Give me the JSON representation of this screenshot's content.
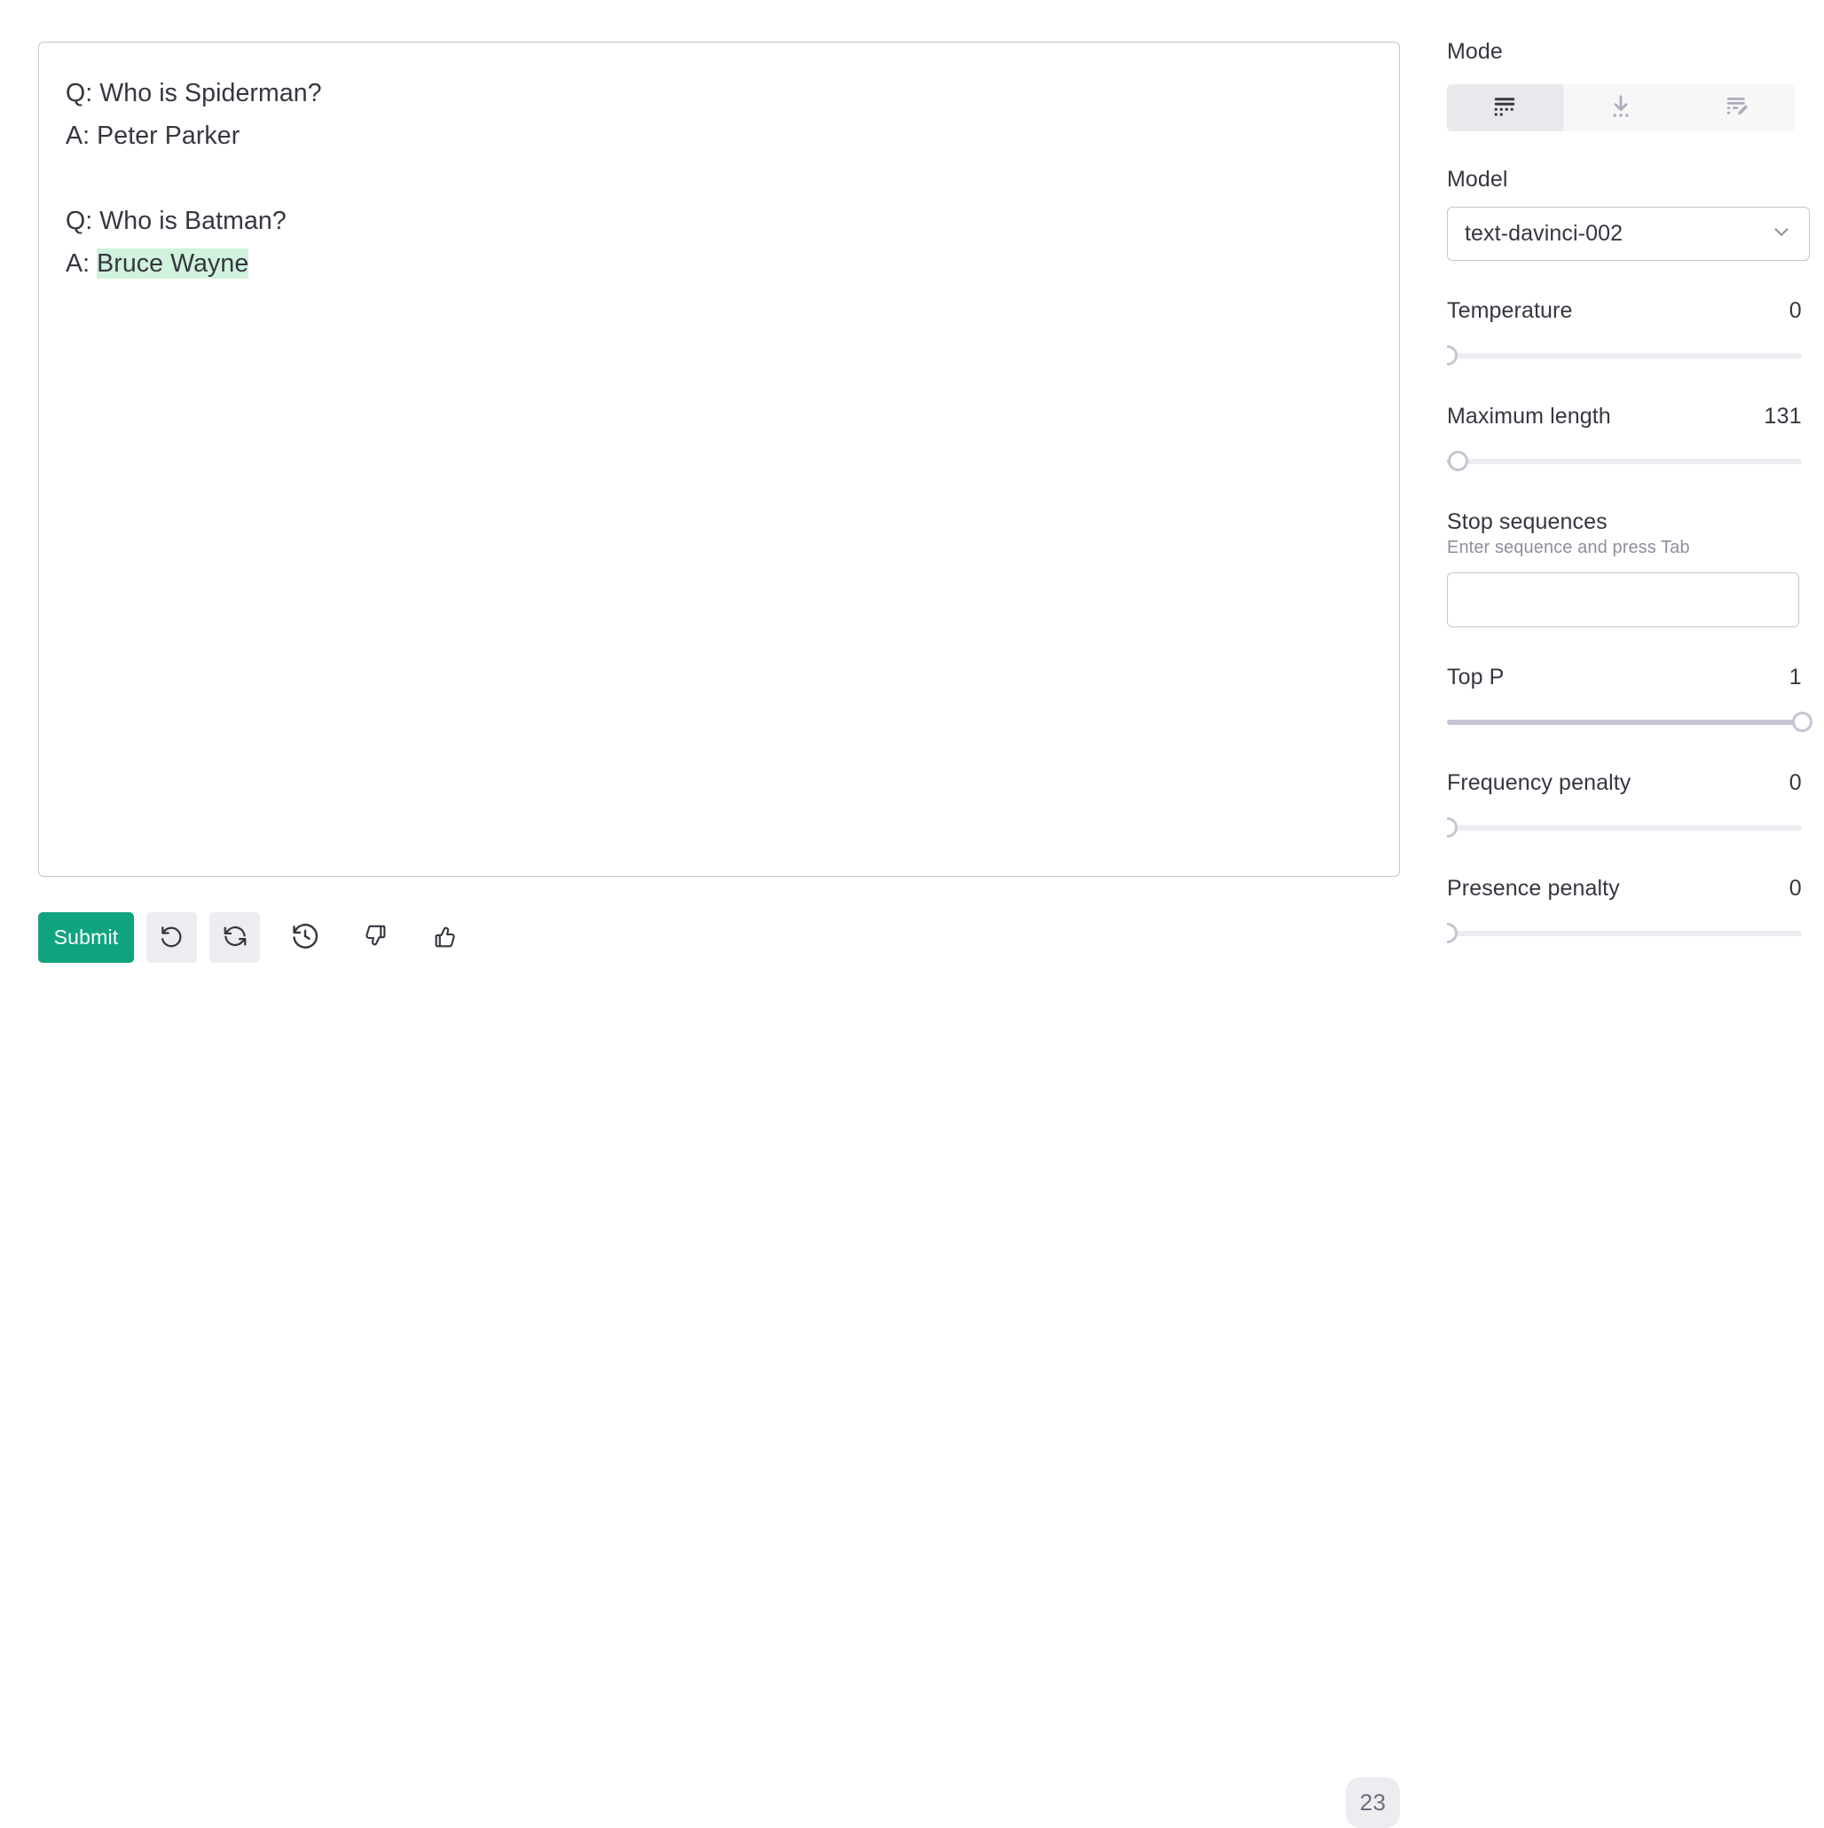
{
  "editor": {
    "prompt_lines": [
      "Q: Who is Spiderman?",
      "A: Peter Parker",
      "",
      "Q: Who is Batman?"
    ],
    "answer_prefix": "A: ",
    "completion_text": "Bruce Wayne",
    "completion_highlight_color": "#d1f2dc"
  },
  "toolbar": {
    "submit_label": "Submit",
    "undo_icon": "undo-icon",
    "regenerate_icon": "regenerate-icon",
    "history_icon": "history-icon",
    "thumbs_down_icon": "thumbs-down-icon",
    "thumbs_up_icon": "thumbs-up-icon",
    "token_count": "23",
    "submit_color": "#10a37f"
  },
  "sidebar": {
    "mode": {
      "label": "Mode",
      "options": [
        {
          "name": "complete",
          "icon": "complete-mode-icon",
          "selected": true
        },
        {
          "name": "insert",
          "icon": "insert-mode-icon",
          "selected": false
        },
        {
          "name": "edit",
          "icon": "edit-mode-icon",
          "selected": false
        }
      ]
    },
    "model": {
      "label": "Model",
      "value": "text-davinci-002",
      "chevron_icon": "chevron-down-icon"
    },
    "temperature": {
      "label": "Temperature",
      "value": "0",
      "percent": 0
    },
    "maximum_length": {
      "label": "Maximum length",
      "value": "131",
      "percent": 3
    },
    "stop_sequences": {
      "label": "Stop sequences",
      "hint": "Enter sequence and press Tab",
      "value": ""
    },
    "top_p": {
      "label": "Top P",
      "value": "1",
      "percent": 100
    },
    "frequency_penalty": {
      "label": "Frequency penalty",
      "value": "0",
      "percent": 0
    },
    "presence_penalty": {
      "label": "Presence penalty",
      "value": "0",
      "percent": 0
    }
  }
}
